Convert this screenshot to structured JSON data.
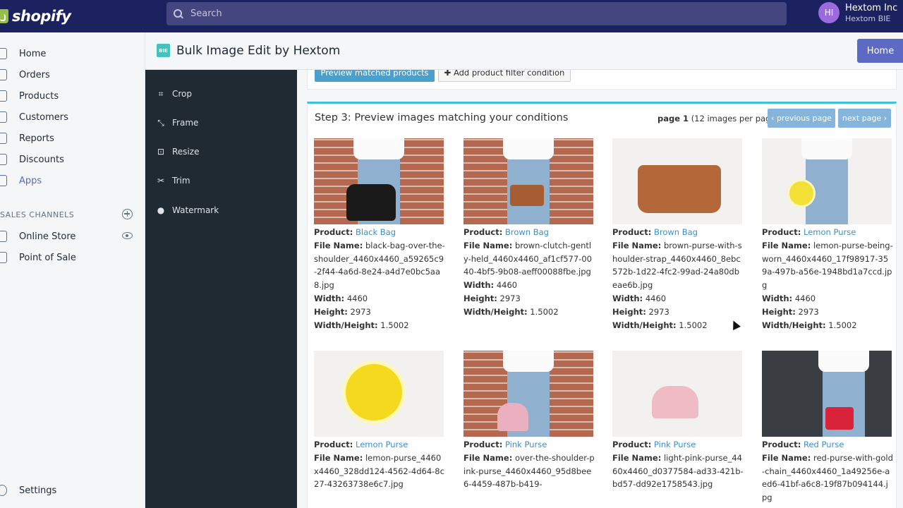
{
  "topbar": {
    "logo_text": "shopify",
    "search_placeholder": "Search",
    "avatar_initials": "HI",
    "user_name": "Hextom Inc",
    "store_name": "Hextom BIE"
  },
  "sidebar": {
    "items": [
      {
        "label": "Home",
        "active": false
      },
      {
        "label": "Orders",
        "active": false
      },
      {
        "label": "Products",
        "active": false
      },
      {
        "label": "Customers",
        "active": false
      },
      {
        "label": "Reports",
        "active": false
      },
      {
        "label": "Discounts",
        "active": false
      },
      {
        "label": "Apps",
        "active": true
      }
    ],
    "channels_title": "SALES CHANNELS",
    "channels": [
      {
        "label": "Online Store"
      },
      {
        "label": "Point of Sale"
      }
    ],
    "settings_label": "Settings"
  },
  "app_header": {
    "logo_text": "BIE",
    "title": "Bulk Image Edit by Hextom",
    "home_button": "Home"
  },
  "app_sidebar": {
    "items": [
      {
        "label": "Crop",
        "icon": "crop-icon"
      },
      {
        "label": "Frame",
        "icon": "frame-icon"
      },
      {
        "label": "Resize",
        "icon": "resize-icon"
      },
      {
        "label": "Trim",
        "icon": "trim-icon"
      },
      {
        "label": "Watermark",
        "icon": "watermark-icon"
      }
    ]
  },
  "filters": {
    "preview_button": "Preview matched products",
    "add_filter_button": "Add product filter condition"
  },
  "step3": {
    "title": "Step 3: Preview images matching your conditions",
    "page_label": "page 1",
    "per_page": "(12 images per page)",
    "prev_button": "previous page",
    "next_button": "next page"
  },
  "labels": {
    "product": "Product:",
    "file_name": "File Name:",
    "width": "Width:",
    "height": "Height:",
    "ratio": "Width/Height:"
  },
  "images": [
    {
      "product": "Black Bag",
      "file_name": "black-bag-over-the-shoulder_4460x4460_a59265c9-2f44-4a6d-8e24-a4d7e0bc5aa8.jpg",
      "width": "4460",
      "height": "2973",
      "ratio": "1.5002"
    },
    {
      "product": "Brown Bag",
      "file_name": "brown-clutch-gently-held_4460x4460_af1cf577-0040-4bf5-9b08-aeff00088fbe.jpg",
      "width": "4460",
      "height": "2973",
      "ratio": "1.5002"
    },
    {
      "product": "Brown Bag",
      "file_name": "brown-purse-with-shoulder-strap_4460x4460_8ebc572b-1d22-4fc2-99ad-24a80dbeae6b.jpg",
      "width": "4460",
      "height": "2973",
      "ratio": "1.5002"
    },
    {
      "product": "Lemon Purse",
      "file_name": "lemon-purse-being-worn_4460x4460_17f98917-359a-497b-a56e-1948bd1a7ccd.jpg",
      "width": "4460",
      "height": "2973",
      "ratio": "1.5002"
    },
    {
      "product": "Lemon Purse",
      "file_name": "lemon-purse_4460x4460_328dd124-4562-4d64-8c27-43263738e6c7.jpg"
    },
    {
      "product": "Pink Purse",
      "file_name": "over-the-shoulder-pink-purse_4460x4460_95d8bee6-4459-487b-b419-"
    },
    {
      "product": "Pink Purse",
      "file_name": "light-pink-purse_4460x4460_d0377584-ad33-421b-bd57-dd92e1758543.jpg"
    },
    {
      "product": "Red Purse",
      "file_name": "red-purse-with-gold-chain_4460x4460_1a49256e-aed6-41bf-a6c8-19f87b094144.jpg"
    }
  ],
  "colors": {
    "topbar": "#1c2260",
    "accent": "#5c6ac4",
    "link": "#3e8ec9",
    "step_border": "#3fc1d8",
    "app_sidebar": "#1f2a33"
  }
}
